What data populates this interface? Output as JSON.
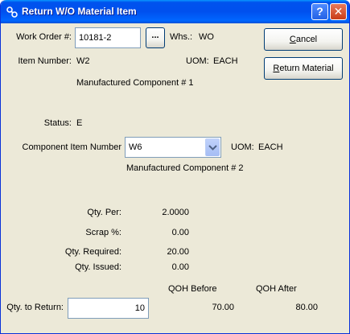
{
  "window": {
    "title": "Return W/O Material Item",
    "help_glyph": "?",
    "close_glyph": "✕"
  },
  "header": {
    "work_order_label": "Work Order #:",
    "work_order_value": "10181-2",
    "lookup_label": "...",
    "whs_label": "Whs.:",
    "whs_value": "WO",
    "item_number_label": "Item Number:",
    "item_number_value": "W2",
    "uom_label": "UOM:",
    "uom_value": "EACH",
    "item_description": "Manufactured Component # 1",
    "status_label": "Status:",
    "status_value": "E"
  },
  "buttons": {
    "cancel_prefix": "",
    "cancel_key": "C",
    "cancel_rest": "ancel",
    "return_prefix": "",
    "return_key": "R",
    "return_rest": "eturn Material"
  },
  "component": {
    "label": "Component Item Number",
    "value": "W6",
    "uom_label": "UOM:",
    "uom_value": "EACH",
    "description": "Manufactured Component # 2"
  },
  "quantities": {
    "qty_per_label": "Qty. Per:",
    "qty_per_value": "2.0000",
    "scrap_label": "Scrap %:",
    "scrap_value": "0.00",
    "required_label": "Qty. Required:",
    "required_value": "20.00",
    "issued_label": "Qty. Issued:",
    "issued_value": "0.00",
    "qoh_before_label": "QOH Before",
    "qoh_after_label": "QOH After",
    "return_label": "Qty. to Return:",
    "return_value": "10",
    "qoh_before_value": "70.00",
    "qoh_after_value": "80.00"
  },
  "colors": {
    "titlebar": "#0053ee",
    "dialog_bg": "#ece9d8",
    "input_border": "#7f9db9"
  }
}
